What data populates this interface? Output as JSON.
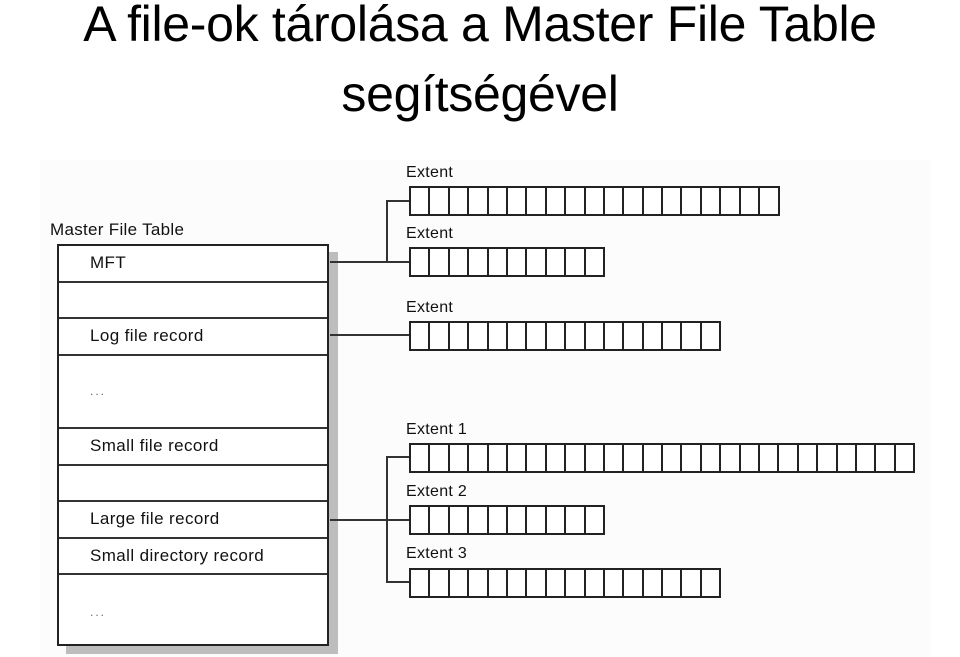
{
  "title": {
    "line1": "A file-ok tárolása a Master File Table",
    "line2": "segítségével"
  },
  "mft": {
    "label": "Master File Table",
    "rows": [
      {
        "text": "MFT",
        "span": 1
      },
      {
        "text": "",
        "span": 1
      },
      {
        "text": "Log file record",
        "span": 1
      },
      {
        "text": "...",
        "span": 2
      },
      {
        "text": "Small file record",
        "span": 1
      },
      {
        "text": "",
        "span": 1
      },
      {
        "text": "Large file record",
        "span": 1
      },
      {
        "text": "Small directory record",
        "span": 1
      },
      {
        "text": "...",
        "span": 2
      }
    ]
  },
  "extents": [
    {
      "label": "Extent",
      "cells": 19,
      "source_row": "MFT"
    },
    {
      "label": "Extent",
      "cells": 10,
      "source_row": "MFT"
    },
    {
      "label": "Extent",
      "cells": 16,
      "source_row": "Log file record"
    },
    {
      "label": "Extent 1",
      "cells": 26,
      "source_row": "Large file record"
    },
    {
      "label": "Extent 2",
      "cells": 10,
      "source_row": "Large file record"
    },
    {
      "label": "Extent 3",
      "cells": 16,
      "source_row": "Large file record"
    }
  ],
  "colors": {
    "line": "#222222",
    "shadow": "#bdbdbd",
    "text": "#111111"
  }
}
